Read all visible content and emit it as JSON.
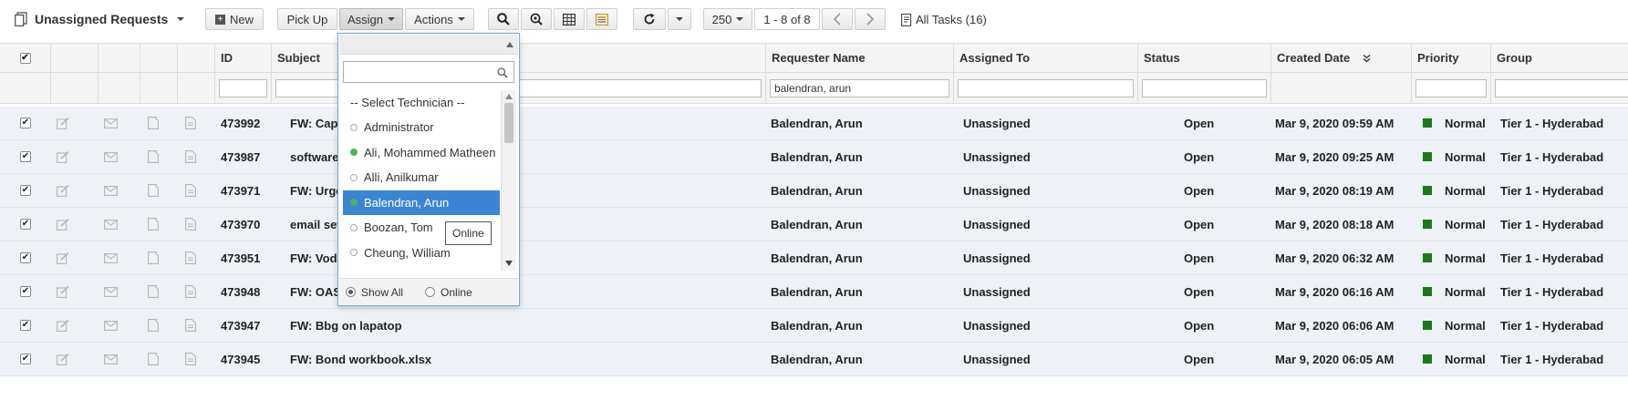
{
  "toolbar": {
    "view_title": "Unassigned Requests",
    "new_label": "New",
    "pickup_label": "Pick Up",
    "assign_label": "Assign",
    "actions_label": "Actions",
    "page_size": "250",
    "page_range": "1 - 8 of 8",
    "all_tasks": "All Tasks (16)"
  },
  "columns": {
    "id": "ID",
    "subject": "Subject",
    "requester": "Requester Name",
    "assigned": "Assigned To",
    "status": "Status",
    "created": "Created Date",
    "priority": "Priority",
    "group": "Group"
  },
  "filters": {
    "requester": "balendran, arun"
  },
  "rows": [
    {
      "id": "473992",
      "subject": "FW: Capl",
      "requester": "Balendran, Arun",
      "assigned": "Unassigned",
      "status": "Open",
      "created": "Mar 9, 2020 09:59 AM",
      "priority": "Normal",
      "group": "Tier 1 - Hyderabad"
    },
    {
      "id": "473987",
      "subject": "software",
      "requester": "Balendran, Arun",
      "assigned": "Unassigned",
      "status": "Open",
      "created": "Mar 9, 2020 09:25 AM",
      "priority": "Normal",
      "group": "Tier 1 - Hyderabad"
    },
    {
      "id": "473971",
      "subject": "FW: Urge",
      "requester": "Balendran, Arun",
      "assigned": "Unassigned",
      "status": "Open",
      "created": "Mar 9, 2020 08:19 AM",
      "priority": "Normal",
      "group": "Tier 1 - Hyderabad"
    },
    {
      "id": "473970",
      "subject": "email set",
      "requester": "Balendran, Arun",
      "assigned": "Unassigned",
      "status": "Open",
      "created": "Mar 9, 2020 08:18 AM",
      "priority": "Normal",
      "group": "Tier 1 - Hyderabad"
    },
    {
      "id": "473951",
      "subject": "FW: Voda",
      "requester": "Balendran, Arun",
      "assigned": "Unassigned",
      "status": "Open",
      "created": "Mar 9, 2020 06:32 AM",
      "priority": "Normal",
      "group": "Tier 1 - Hyderabad"
    },
    {
      "id": "473948",
      "subject": "FW: OAS",
      "requester": "Balendran, Arun",
      "assigned": "Unassigned",
      "status": "Open",
      "created": "Mar 9, 2020 06:16 AM",
      "priority": "Normal",
      "group": "Tier 1 - Hyderabad"
    },
    {
      "id": "473947",
      "subject": "FW: Bbg on lapatop",
      "requester": "Balendran, Arun",
      "assigned": "Unassigned",
      "status": "Open",
      "created": "Mar 9, 2020 06:06 AM",
      "priority": "Normal",
      "group": "Tier 1 - Hyderabad"
    },
    {
      "id": "473945",
      "subject": "FW: Bond workbook.xlsx",
      "requester": "Balendran, Arun",
      "assigned": "Unassigned",
      "status": "Open",
      "created": "Mar 9, 2020 06:05 AM",
      "priority": "Normal",
      "group": "Tier 1 - Hyderabad"
    }
  ],
  "dropdown": {
    "select_label": "-- Select Technician --",
    "technicians": [
      {
        "name": "Administrator",
        "online": false,
        "selected": false
      },
      {
        "name": "Ali, Mohammed Matheen",
        "online": true,
        "selected": false
      },
      {
        "name": "Alli, Anilkumar",
        "online": false,
        "selected": false
      },
      {
        "name": "Balendran, Arun",
        "online": true,
        "selected": true
      },
      {
        "name": "Boozan, Tom",
        "online": false,
        "selected": false
      },
      {
        "name": "Cheung, William",
        "online": false,
        "selected": false
      }
    ],
    "show_all": "Show All",
    "online": "Online",
    "tooltip": "Online"
  },
  "colors": {
    "selected_bg": "#3c85d5",
    "online_dot": "#4fb35a",
    "priority_normal": "#1a7a1a",
    "row_bg": "#eef2f6"
  }
}
